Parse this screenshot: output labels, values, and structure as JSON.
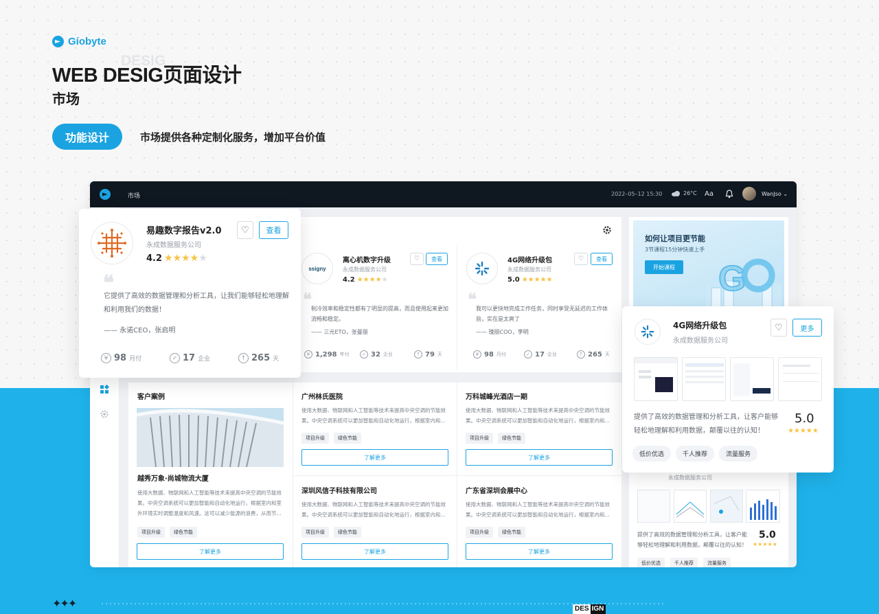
{
  "brand": {
    "name": "Gíobyte",
    "accent": "#1aa3e0"
  },
  "hero": {
    "title": "WEB DESIG页面设计",
    "ghost": "DESIG",
    "subtitle": "市场",
    "pill": "功能设计",
    "tagline": "市场提供各种定制化服务，增加平台价值"
  },
  "topbar": {
    "nav": "市场",
    "datetime": "2022–05–12  15:30",
    "weather": "26°C",
    "font": "Aa",
    "user": "WanJso"
  },
  "products": [
    {
      "name": "易趣数字报告v2.0",
      "company": "永成数据服务公司",
      "rating": "4.2",
      "quote": "它提供了高效的数据管理和分析工具，让我们能够轻松地理解和利用我们的数据！",
      "author": "—— 永诺CEO，张启明",
      "stats": [
        {
          "num": "98",
          "unit": "月付"
        },
        {
          "num": "17",
          "unit": "企业"
        },
        {
          "num": "265",
          "unit": "天"
        }
      ],
      "view": "查看"
    },
    {
      "name": "离心机数字升级",
      "company": "永成数据服务公司",
      "rating": "4.2",
      "logo_text": "ssigny",
      "quote": "制冷效率和稳定性都有了明显的提高，而且使用起来更加流畅和稳定。",
      "author": "—— 三元ETO，张曼丽",
      "stats": [
        {
          "num": "1,298",
          "unit": "年付"
        },
        {
          "num": "32",
          "unit": "企业"
        },
        {
          "num": "79",
          "unit": "天"
        }
      ],
      "view": "查看"
    },
    {
      "name": "4G网络升级包",
      "company": "永成数据服务公司",
      "rating": "5.0",
      "quote": "我可以更快地完成工作任务，同时享受无延迟的工作体验，实在是太爽了",
      "author": "—— 瑰丽COO，李明",
      "stats": [
        {
          "num": "98",
          "unit": "月付"
        },
        {
          "num": "17",
          "unit": "企业"
        },
        {
          "num": "265",
          "unit": "天"
        }
      ],
      "view": "查看"
    }
  ],
  "course": {
    "title": "如何让项目更节能",
    "sub": "3节课程15分钟快速上手",
    "btn": "开始课程"
  },
  "cases": {
    "header": "客户案例",
    "featured": {
      "title": "越秀万象·尚城物流大厦",
      "desc": "使用大数据、物联网和人工智能等技术来提高中央空调的节能效果。中央空调系统可以更加智能和自动化地运行，根据室内和室外环境实时调整温度和风速。这可以减少能源的浪费，从而节...",
      "tags": [
        "项目升级",
        "绿色节能"
      ],
      "btn": "了解更多"
    },
    "items": [
      {
        "title": "广州林氏医院",
        "desc": "使用大数据、物联网和人工智能等技术来提高中央空调的节能效果。中央空调系统可以更加智能和自动化地运行，根据室内和...",
        "tags": [
          "项目升级",
          "绿色节能"
        ],
        "btn": "了解更多"
      },
      {
        "title": "万科城峰光酒店一期",
        "desc": "使用大数据、物联网和人工智能等技术来提高中央空调的节能效果。中央空调系统可以更加智能和自动化地运行，根据室内和...",
        "tags": [
          "项目升级",
          "绿色节能"
        ],
        "btn": "了解更多"
      },
      {
        "title": "深圳风信子科技有限公司",
        "desc": "使用大数据、物联网和人工智能等技术来提高中央空调的节能效果。中央空调系统可以更加智能和自动化地运行，根据室内和...",
        "tags": [
          "项目升级",
          "绿色节能"
        ],
        "btn": "了解更多"
      },
      {
        "title": "广东省深圳会展中心",
        "desc": "使用大数据、物联网和人工智能等技术来提高中央空调的节能效果。中央空调系统可以更加智能和自动化地运行，根据室内和...",
        "tags": [
          "项目升级",
          "绿色节能"
        ],
        "btn": "了解更多"
      }
    ]
  },
  "bottom_card": {
    "company": "永成数据服务公司",
    "desc": "提供了高效的数据管理和分析工具，让客户能够轻松地理解和利用数据，颠覆以往的认知！",
    "rating": "5.0",
    "chips": [
      "低价优选",
      "千人推荐",
      "流量服务"
    ]
  },
  "float_left": {
    "name": "易趣数字报告v2.0",
    "company": "永成数据服务公司",
    "rating": "4.2",
    "view": "查看",
    "quote": "它提供了高效的数据管理和分析工具，让我们能够轻松地理解和利用我们的数据！",
    "author": "—— 永诺CEO，张启明",
    "stats": [
      {
        "num": "98",
        "unit": "月付"
      },
      {
        "num": "17",
        "unit": "企业"
      },
      {
        "num": "265",
        "unit": "天"
      }
    ]
  },
  "float_right": {
    "name": "4G网络升级包",
    "company": "永成数据服务公司",
    "more": "更多",
    "desc": "提供了高效的数据管理和分析工具，让客户能够轻松地理解和利用数据，颠覆以往的认知！",
    "rating": "5.0",
    "chips": [
      "低价优选",
      "千人推荐",
      "流量服务"
    ]
  },
  "footer": {
    "design_a": "DES",
    "design_b": "IGN"
  }
}
